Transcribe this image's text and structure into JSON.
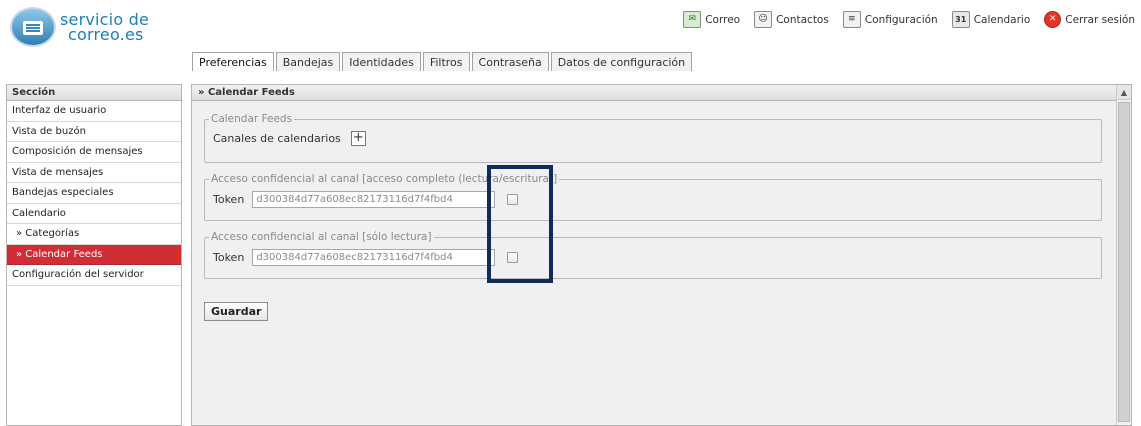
{
  "logo": {
    "line1": "servicio de",
    "line2": "correo.es"
  },
  "topnav": [
    {
      "icon": "mail-icon",
      "glyph": "✉",
      "label": "Correo"
    },
    {
      "icon": "contacts-icon",
      "glyph": "☺",
      "label": "Contactos"
    },
    {
      "icon": "settings-icon",
      "glyph": "≡",
      "label": "Configuración"
    },
    {
      "icon": "calendar-icon",
      "glyph": "31",
      "label": "Calendario"
    },
    {
      "icon": "close-icon",
      "glyph": "✕",
      "label": "Cerrar sesión"
    }
  ],
  "tabs": [
    {
      "label": "Preferencias",
      "active": true
    },
    {
      "label": "Bandejas"
    },
    {
      "label": "Identidades"
    },
    {
      "label": "Filtros"
    },
    {
      "label": "Contraseña"
    },
    {
      "label": "Datos de configuración"
    }
  ],
  "sidebar": {
    "header": "Sección",
    "items": [
      {
        "label": "Interfaz de usuario"
      },
      {
        "label": "Vista de buzón"
      },
      {
        "label": "Composición de mensajes"
      },
      {
        "label": "Vista de mensajes"
      },
      {
        "label": "Bandejas especiales"
      },
      {
        "label": "Calendario"
      },
      {
        "label": "» Categorías",
        "sub": true
      },
      {
        "label": "» Calendar Feeds",
        "sub": true,
        "active": true
      },
      {
        "label": "Configuración del servidor"
      }
    ]
  },
  "main": {
    "header": "» Calendar Feeds",
    "feeds": {
      "legend": "Calendar Feeds",
      "label": "Canales de calendarios",
      "add_glyph": "+"
    },
    "full_access": {
      "legend": "Acceso confidencial al canal [acceso completo (lectura/escritura)]",
      "token_label": "Token",
      "token_value": "d300384d77a608ec82173116d7f4fbd4"
    },
    "read_only": {
      "legend": "Acceso confidencial al canal [sólo lectura]",
      "token_label": "Token",
      "token_value": "d300384d77a608ec82173116d7f4fbd4"
    },
    "save_label": "Guardar"
  },
  "colors": {
    "accent": "#d12d35",
    "highlight": "#0f2a5c",
    "brand": "#1f7db8"
  }
}
